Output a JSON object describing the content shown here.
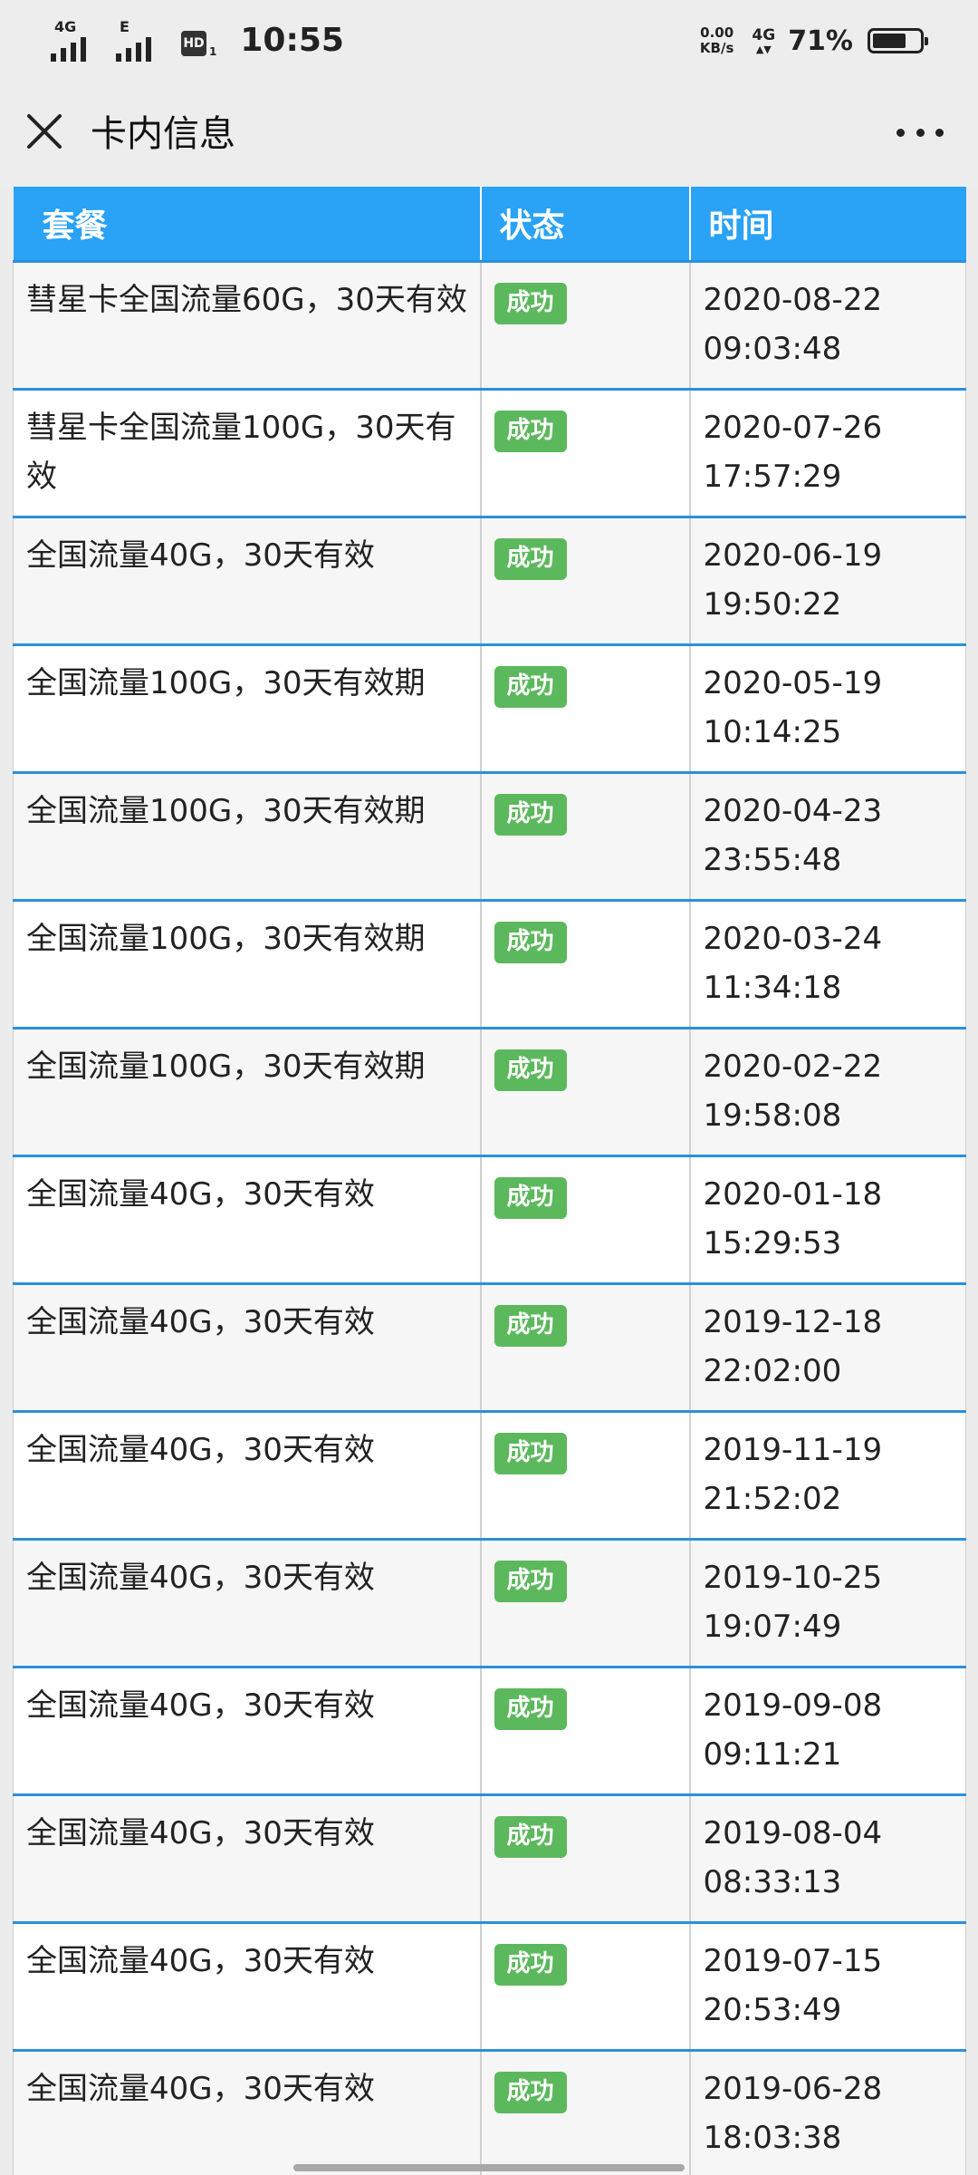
{
  "status_bar": {
    "signal1_tag": "4G",
    "signal2_tag": "E",
    "hd_label": "HD",
    "hd_sub": "1",
    "time": "10:55",
    "speed_value": "0.00",
    "speed_unit": "KB/s",
    "net_type": "4G",
    "net_arrows": "▲▼",
    "battery_percent": "71%",
    "battery_level": 0.71
  },
  "title_bar": {
    "title": "卡内信息",
    "close_icon": "close-icon",
    "more_icon": "more-icon"
  },
  "table": {
    "columns": [
      "套餐",
      "状态",
      "时间"
    ],
    "rows": [
      {
        "plan": "彗星卡全国流量60G，30天有效",
        "status": "成功",
        "date": "2020-08-22",
        "time": "09:03:48"
      },
      {
        "plan": "彗星卡全国流量100G，30天有效",
        "status": "成功",
        "date": "2020-07-26",
        "time": "17:57:29"
      },
      {
        "plan": "全国流量40G，30天有效",
        "status": "成功",
        "date": "2020-06-19",
        "time": "19:50:22"
      },
      {
        "plan": "全国流量100G，30天有效期",
        "status": "成功",
        "date": "2020-05-19",
        "time": "10:14:25"
      },
      {
        "plan": "全国流量100G，30天有效期",
        "status": "成功",
        "date": "2020-04-23",
        "time": "23:55:48"
      },
      {
        "plan": "全国流量100G，30天有效期",
        "status": "成功",
        "date": "2020-03-24",
        "time": "11:34:18"
      },
      {
        "plan": "全国流量100G，30天有效期",
        "status": "成功",
        "date": "2020-02-22",
        "time": "19:58:08"
      },
      {
        "plan": "全国流量40G，30天有效",
        "status": "成功",
        "date": "2020-01-18",
        "time": "15:29:53"
      },
      {
        "plan": "全国流量40G，30天有效",
        "status": "成功",
        "date": "2019-12-18",
        "time": "22:02:00"
      },
      {
        "plan": "全国流量40G，30天有效",
        "status": "成功",
        "date": "2019-11-19",
        "time": "21:52:02"
      },
      {
        "plan": "全国流量40G，30天有效",
        "status": "成功",
        "date": "2019-10-25",
        "time": "19:07:49"
      },
      {
        "plan": "全国流量40G，30天有效",
        "status": "成功",
        "date": "2019-09-08",
        "time": "09:11:21"
      },
      {
        "plan": "全国流量40G，30天有效",
        "status": "成功",
        "date": "2019-08-04",
        "time": "08:33:13"
      },
      {
        "plan": "全国流量40G，30天有效",
        "status": "成功",
        "date": "2019-07-15",
        "time": "20:53:49"
      },
      {
        "plan": "全国流量40G，30天有效",
        "status": "成功",
        "date": "2019-06-28",
        "time": "18:03:38"
      }
    ]
  },
  "colors": {
    "header_bg": "#2aa2f5",
    "row_border": "#2d8fdc",
    "badge_bg": "#5cb85c"
  }
}
